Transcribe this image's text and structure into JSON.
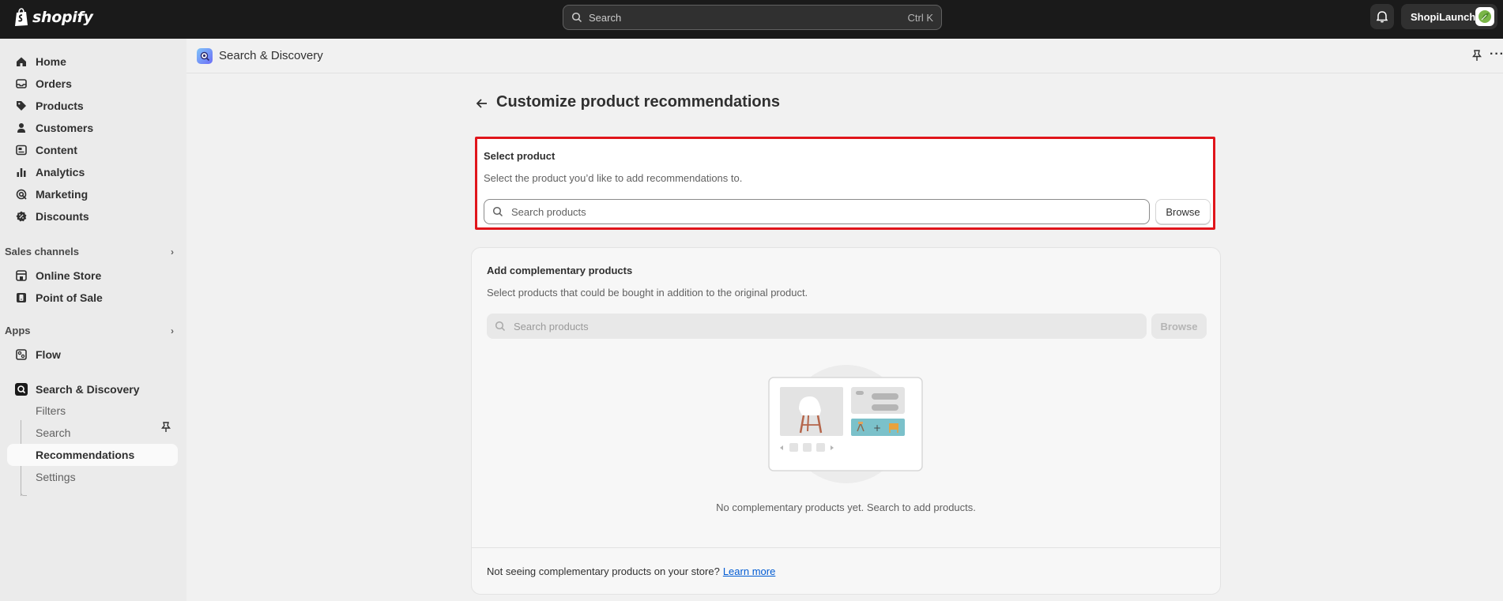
{
  "topbar": {
    "logo_text": "shopify",
    "search_placeholder": "Search",
    "search_shortcut": "Ctrl K",
    "store_name": "ShopiLaunch"
  },
  "sidebar": {
    "items": [
      {
        "label": "Home",
        "icon": "home-icon"
      },
      {
        "label": "Orders",
        "icon": "inbox-icon"
      },
      {
        "label": "Products",
        "icon": "tag-icon"
      },
      {
        "label": "Customers",
        "icon": "person-icon"
      },
      {
        "label": "Content",
        "icon": "content-icon"
      },
      {
        "label": "Analytics",
        "icon": "bar-chart-icon"
      },
      {
        "label": "Marketing",
        "icon": "target-icon"
      },
      {
        "label": "Discounts",
        "icon": "discount-icon"
      }
    ],
    "sales_channels_title": "Sales channels",
    "sales_channels": [
      {
        "label": "Online Store",
        "icon": "store-icon"
      },
      {
        "label": "Point of Sale",
        "icon": "pos-icon"
      }
    ],
    "apps_title": "Apps",
    "apps": [
      {
        "label": "Flow",
        "icon": "flow-icon"
      }
    ],
    "app": {
      "label": "Search & Discovery",
      "sub_items": [
        "Filters",
        "Search",
        "Recommendations",
        "Settings"
      ],
      "active_sub_item": "Recommendations"
    }
  },
  "app_header": {
    "title": "Search & Discovery"
  },
  "page": {
    "title": "Customize product recommendations",
    "select_product": {
      "title": "Select product",
      "description": "Select the product you’d like to add recommendations to.",
      "search_placeholder": "Search products",
      "browse_label": "Browse"
    },
    "complementary": {
      "title": "Add complementary products",
      "description": "Select products that could be bought in addition to the original product.",
      "search_placeholder": "Search products",
      "browse_label": "Browse",
      "empty_text": "No complementary products yet. Search to add products.",
      "footnote": "Not seeing complementary products on your store?",
      "learn_more": "Learn more"
    }
  },
  "colors": {
    "topbar": "#1a1a1a",
    "highlight_border": "#e0151b",
    "link": "#005bd3"
  }
}
